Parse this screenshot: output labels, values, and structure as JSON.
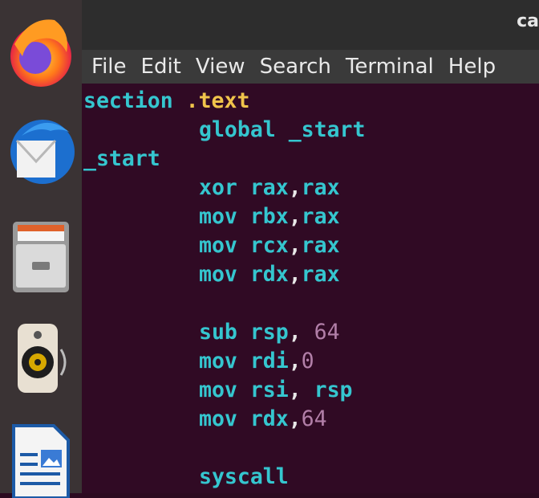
{
  "window": {
    "title_partial": "ca"
  },
  "menu": [
    "File",
    "Edit",
    "View",
    "Search",
    "Terminal",
    "Help"
  ],
  "dock": [
    {
      "name": "firefox-icon"
    },
    {
      "name": "thunderbird-icon"
    },
    {
      "name": "files-icon"
    },
    {
      "name": "rhythmbox-icon"
    },
    {
      "name": "libreoffice-writer-icon"
    }
  ],
  "code": {
    "l1": [
      "section",
      " .text"
    ],
    "l2": [
      "global",
      " _start"
    ],
    "l3": [
      "_start"
    ],
    "l4": [
      "xor",
      " rax",
      ",",
      "rax"
    ],
    "l5": [
      "mov",
      " rbx",
      ",",
      "rax"
    ],
    "l6": [
      "mov",
      " rcx",
      ",",
      "rax"
    ],
    "l7": [
      "mov",
      " rdx",
      ",",
      "rax"
    ],
    "l8": [
      "sub",
      " rsp",
      ", ",
      "64"
    ],
    "l9": [
      "mov",
      " rdi",
      ",",
      "0"
    ],
    "l10": [
      "mov",
      " rsi",
      ", ",
      "rsp"
    ],
    "l11": [
      "mov",
      " rdx",
      ",",
      "64"
    ],
    "l12": [
      "syscall"
    ]
  },
  "colors": {
    "keyword": "#35c6cf",
    "directive": "#f0c44b",
    "number": "#b27fa8",
    "background": "#300a24"
  }
}
